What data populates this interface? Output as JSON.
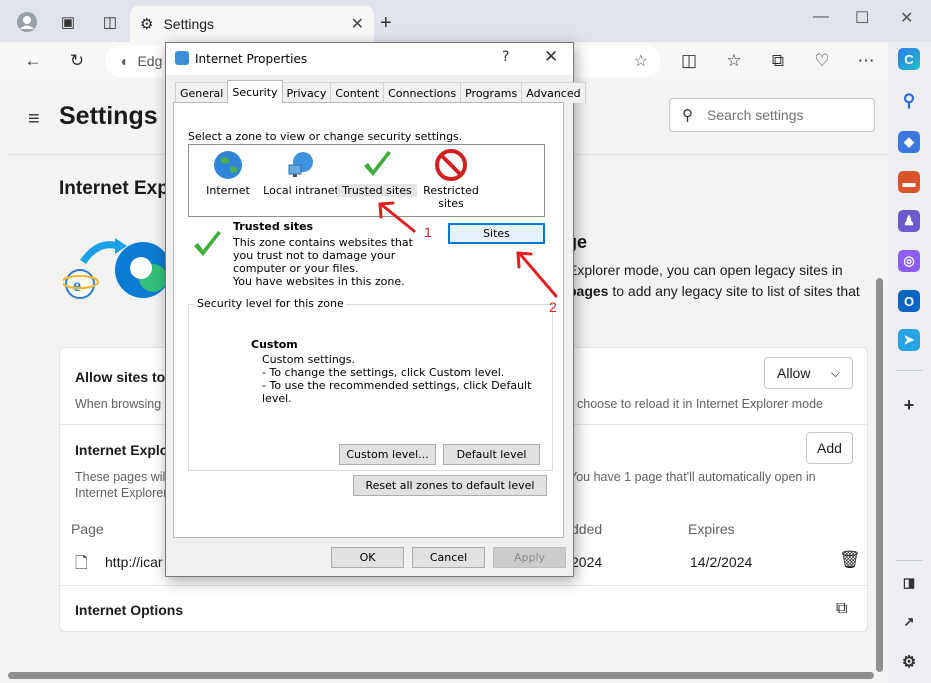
{
  "browser": {
    "tab_title": "Settings",
    "address_text": "Edg"
  },
  "settings": {
    "title": "Settings",
    "search_placeholder": "Search settings",
    "section_title": "Internet Exp",
    "hero_title": "ge",
    "hero_text_1": "Explorer mode, you can open legacy sites in",
    "hero_text_2_bold": "pages",
    "hero_text_2": " to add any legacy site to list of sites that",
    "allow_title": "Allow sites to",
    "allow_sub_left": "When browsing i",
    "allow_sub_right": "choose to reload it in Internet Explorer mode",
    "allow_value": "Allow",
    "ie_pages_title": "Internet Explor",
    "ie_pages_sub_left_1": "These pages will",
    "ie_pages_sub_left_2": "Internet Explorer",
    "ie_pages_sub_right": "You have 1 page that'll automatically open in",
    "add_label": "Add",
    "col_page": "Page",
    "col_added": "dded",
    "col_expires": "Expires",
    "row_url": "http://icar",
    "row_added": "2024",
    "row_expires": "14/2/2024",
    "internet_options": "Internet Options"
  },
  "dialog": {
    "title": "Internet Properties",
    "help": "?",
    "tabs": [
      "General",
      "Security",
      "Privacy",
      "Content",
      "Connections",
      "Programs",
      "Advanced"
    ],
    "active_tab": "Security",
    "zone_hint": "Select a zone to view or change security settings.",
    "zones": [
      {
        "label": "Internet",
        "icon": "globe-icon"
      },
      {
        "label": "Local intranet",
        "icon": "intranet-icon"
      },
      {
        "label": "Trusted sites",
        "icon": "checkmark-icon"
      },
      {
        "label": "Restricted sites",
        "icon": "no-entry-icon"
      }
    ],
    "zone_title": "Trusted sites",
    "zone_desc": "This zone contains websites that you trust not to damage your computer or your files.",
    "zone_have": "You have websites in this zone.",
    "sites_button": "Sites",
    "security_level_legend": "Security level for this zone",
    "custom_title": "Custom",
    "custom_line_1": "Custom settings.",
    "custom_line_2": "- To change the settings, click Custom level.",
    "custom_line_3": "- To use the recommended settings, click Default level.",
    "custom_level_button": "Custom level...",
    "default_level_button": "Default level",
    "reset_button": "Reset all zones to default level",
    "ok": "OK",
    "cancel": "Cancel",
    "apply": "Apply"
  },
  "annotations": {
    "label_1": "1",
    "label_2": "2",
    "color": "#e02020"
  }
}
